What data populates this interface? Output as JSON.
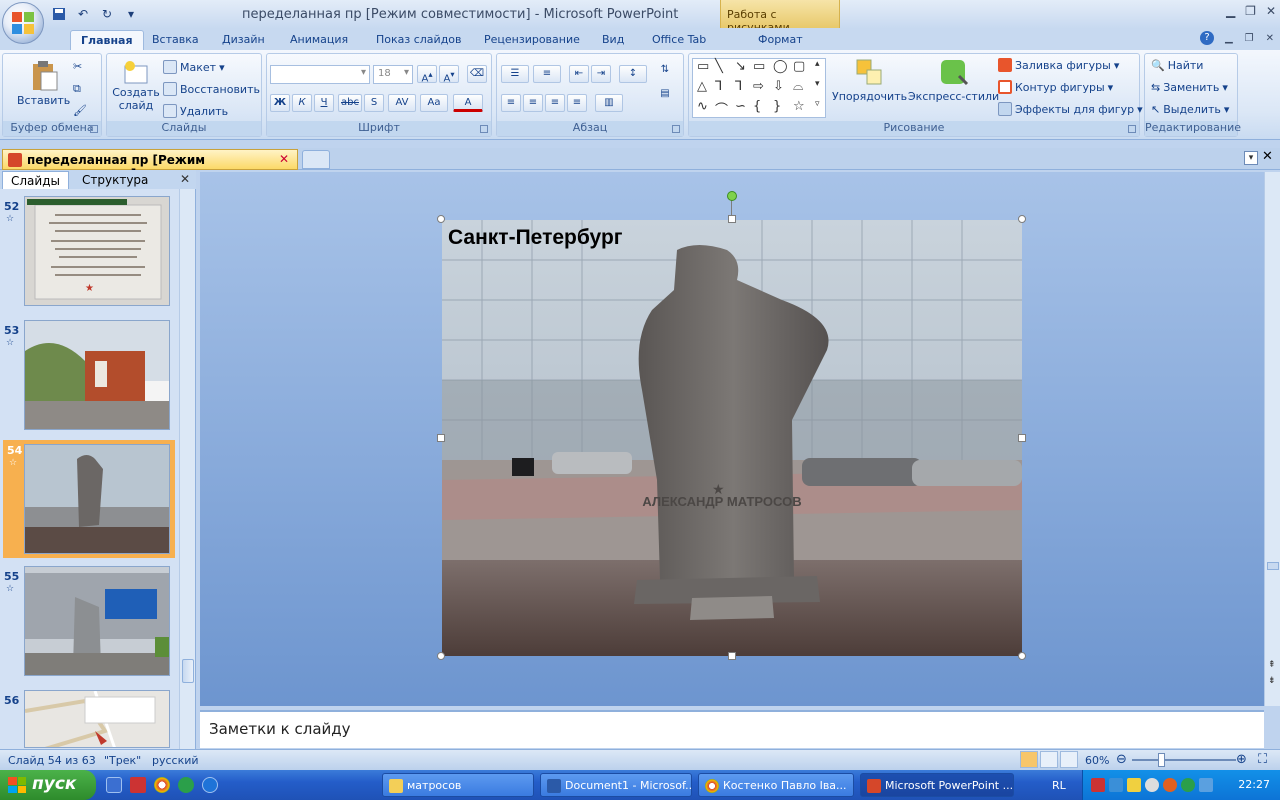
{
  "window": {
    "title": "переделанная пр [Режим совместимости] - Microsoft PowerPoint",
    "context_tool": "Работа с рисунками"
  },
  "tabs": [
    "Главная",
    "Вставка",
    "Дизайн",
    "Анимация",
    "Показ слайдов",
    "Рецензирование",
    "Вид",
    "Office Tab",
    "Формат"
  ],
  "ribbon": {
    "clipboard": {
      "paste": "Вставить",
      "label": "Буфер обмена"
    },
    "slides": {
      "create": "Создать слайд",
      "layout": "Макет",
      "reset": "Восстановить",
      "delete": "Удалить",
      "label": "Слайды"
    },
    "font": {
      "size": "18",
      "label": "Шрифт",
      "bold": "Ж",
      "italic": "К",
      "underline": "Ч",
      "strike": "abc",
      "shadow": "S",
      "spacing": "AV",
      "case": "Aa",
      "color": "A"
    },
    "paragraph": {
      "label": "Абзац"
    },
    "drawing": {
      "arrange": "Упорядочить",
      "styles": "Экспресс-стили",
      "fill": "Заливка фигуры",
      "outline": "Контур фигуры",
      "effects": "Эффекты для фигур",
      "label": "Рисование"
    },
    "editing": {
      "find": "Найти",
      "replace": "Заменить",
      "select": "Выделить",
      "label": "Редактирование"
    }
  },
  "doc_tab": {
    "label": "переделанная пр [Режим совместимости]"
  },
  "left_panel": {
    "tab_slides": "Слайды",
    "tab_outline": "Структура",
    "thumbnails": [
      {
        "num": "52"
      },
      {
        "num": "53"
      },
      {
        "num": "54"
      },
      {
        "num": "55"
      },
      {
        "num": "56"
      }
    ]
  },
  "slide": {
    "title": "Санкт-Петербург",
    "monument_text": "АЛЕКСАНДР МАТРОСОВ"
  },
  "notes": {
    "placeholder": "Заметки к слайду"
  },
  "status": {
    "slide": "Слайд 54 из 63",
    "theme": "\"Трек\"",
    "lang": "русский",
    "zoom": "60%"
  },
  "taskbar": {
    "start": "пуск",
    "tasks": [
      "матросов",
      "Document1 - Microsof...",
      "Костенко Павло Іва...",
      "Microsoft PowerPoint ..."
    ],
    "lang": "RL",
    "clock": "22:27"
  },
  "colors": {
    "accent": "#15428b",
    "ribbon": "#dbe7f6",
    "selection": "#f7b04f"
  }
}
